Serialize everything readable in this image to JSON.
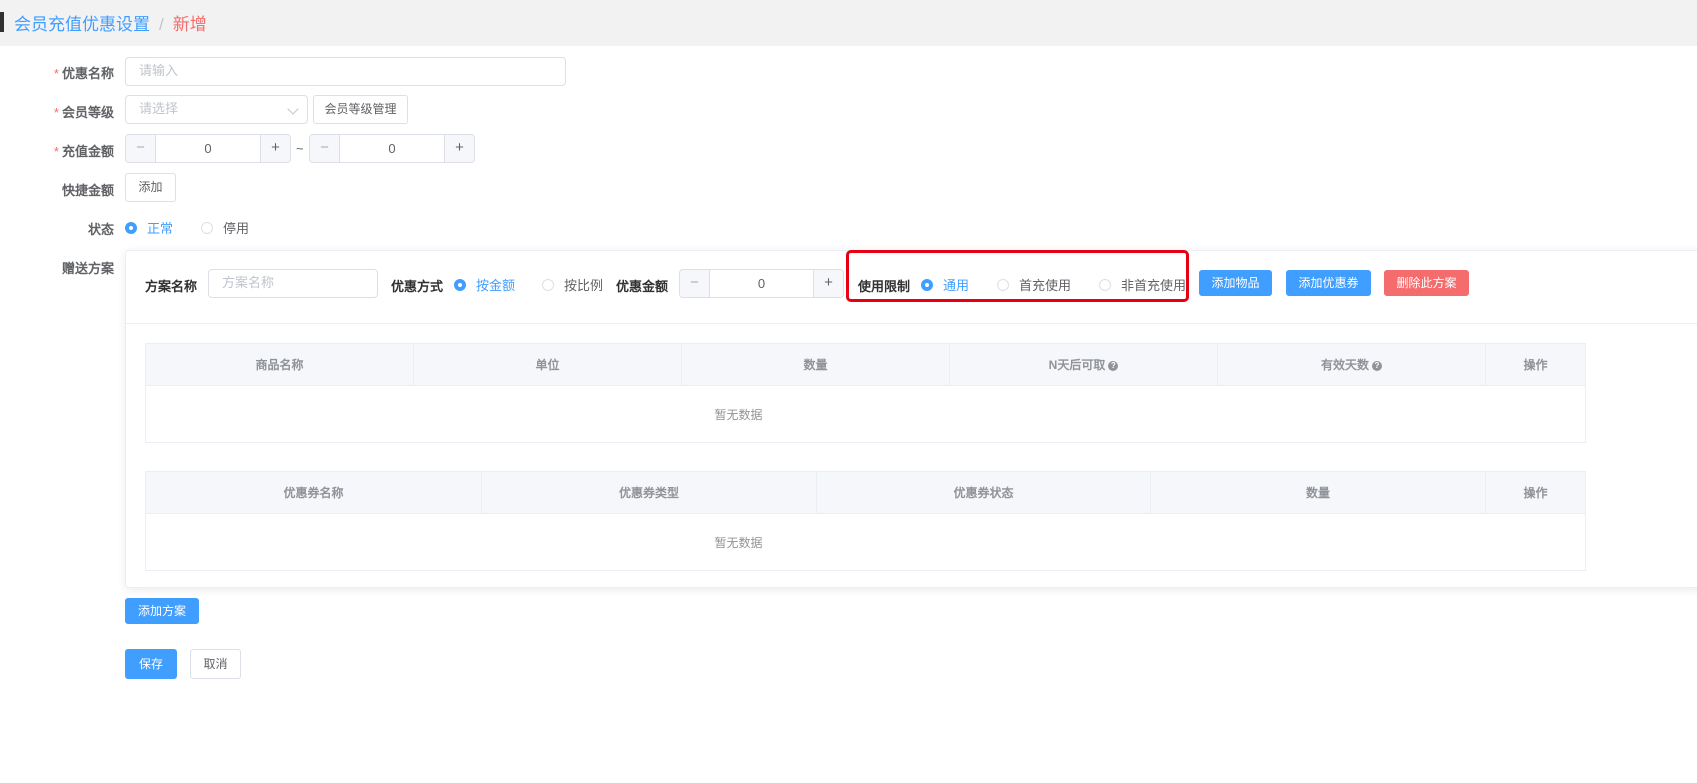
{
  "breadcrumb": {
    "parent": "会员充值优惠设置",
    "separator": "/",
    "current": "新增"
  },
  "form": {
    "name": {
      "label": "优惠名称",
      "required_mark": "*",
      "placeholder": "请输入"
    },
    "level": {
      "label": "会员等级",
      "required_mark": "*",
      "placeholder": "请选择",
      "manage_button": "会员等级管理"
    },
    "amount": {
      "label": "充值金额",
      "required_mark": "*",
      "min_value": "0",
      "max_value": "0",
      "range_sep": "~",
      "minus": "−",
      "plus": "+"
    },
    "quick": {
      "label": "快捷金额",
      "add_button": "添加"
    },
    "status": {
      "label": "状态",
      "options": [
        "正常",
        "停用"
      ],
      "selected": "正常"
    },
    "gift": {
      "label": "赠送方案"
    }
  },
  "plan": {
    "name_label": "方案名称",
    "name_placeholder": "方案名称",
    "mode_label": "优惠方式",
    "mode_options": [
      "按金额",
      "按比例"
    ],
    "mode_selected": "按金额",
    "amount_label": "优惠金额",
    "amount_value": "0",
    "limit_label": "使用限制",
    "limit_options": [
      "通用",
      "首充使用",
      "非首充使用"
    ],
    "limit_selected": "通用",
    "add_item_button": "添加物品",
    "add_coupon_button": "添加优惠券",
    "delete_button": "删除此方案",
    "items_table": {
      "columns": [
        "商品名称",
        "单位",
        "数量",
        "N天后可取",
        "有效天数",
        "操作"
      ],
      "empty_text": "暂无数据"
    },
    "coupons_table": {
      "columns": [
        "优惠券名称",
        "优惠券类型",
        "优惠券状态",
        "数量",
        "操作"
      ],
      "empty_text": "暂无数据"
    }
  },
  "actions": {
    "add_plan": "添加方案",
    "save": "保存",
    "cancel": "取消"
  },
  "colors": {
    "primary": "#409eff",
    "danger": "#f56c6c",
    "highlight": "#e60012"
  }
}
